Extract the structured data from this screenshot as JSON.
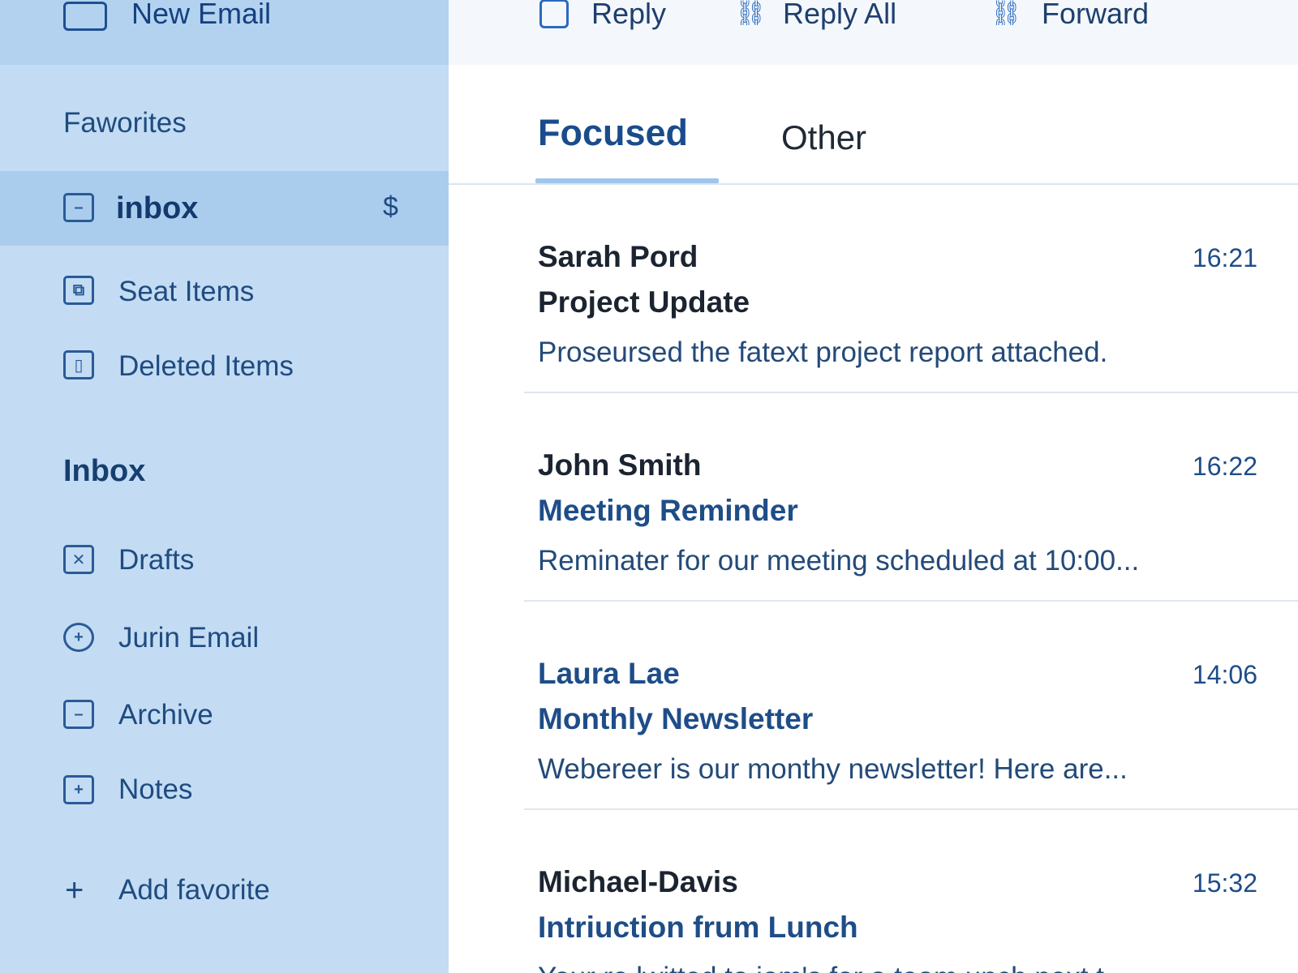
{
  "sidebar": {
    "new_email_label": "New Email",
    "favorites_title": "Faworites",
    "favorites": [
      {
        "label": "inbox",
        "icon": "inbox-icon",
        "badge": "$",
        "active": true
      },
      {
        "label": "Seat Items",
        "icon": "sent-icon"
      },
      {
        "label": "Deleted Items",
        "icon": "trash-icon"
      }
    ],
    "inbox_title": "Inbox",
    "folders": [
      {
        "label": "Drafts",
        "icon": "drafts-icon"
      },
      {
        "label": "Jurin Email",
        "icon": "junk-icon"
      },
      {
        "label": "Archive",
        "icon": "archive-icon"
      },
      {
        "label": "Notes",
        "icon": "notes-icon"
      }
    ],
    "add_favorite_label": "Add favorite"
  },
  "toolbar": {
    "reply_label": "Reply",
    "reply_all_label": "Reply All",
    "forward_label": "Forward"
  },
  "tabs": {
    "focused_label": "Focused",
    "other_label": "Other"
  },
  "messages": [
    {
      "sender": "Sarah Pord",
      "time": "16:21",
      "subject": "Project Update",
      "preview": "Proseursed the fatext project report attached."
    },
    {
      "sender": "John Smith",
      "time": "16:22",
      "subject": "Meeting Reminder",
      "preview": "Reminater for our meeting scheduled at 10:00..."
    },
    {
      "sender": "Laura Lae",
      "time": "14:06",
      "subject": "Monthly Newsletter",
      "preview": "Webereer is our monthy newsletter! Here are..."
    },
    {
      "sender": "Michael-Davis",
      "time": "15:32",
      "subject": "Intriuction  frum Lunch",
      "preview": "Your re lwitted to iom's for a team  unch next t..."
    }
  ],
  "colors": {
    "sidebar_bg": "#c3dcf3",
    "active_item_bg": "#aacdee",
    "accent": "#1a4c8c"
  }
}
